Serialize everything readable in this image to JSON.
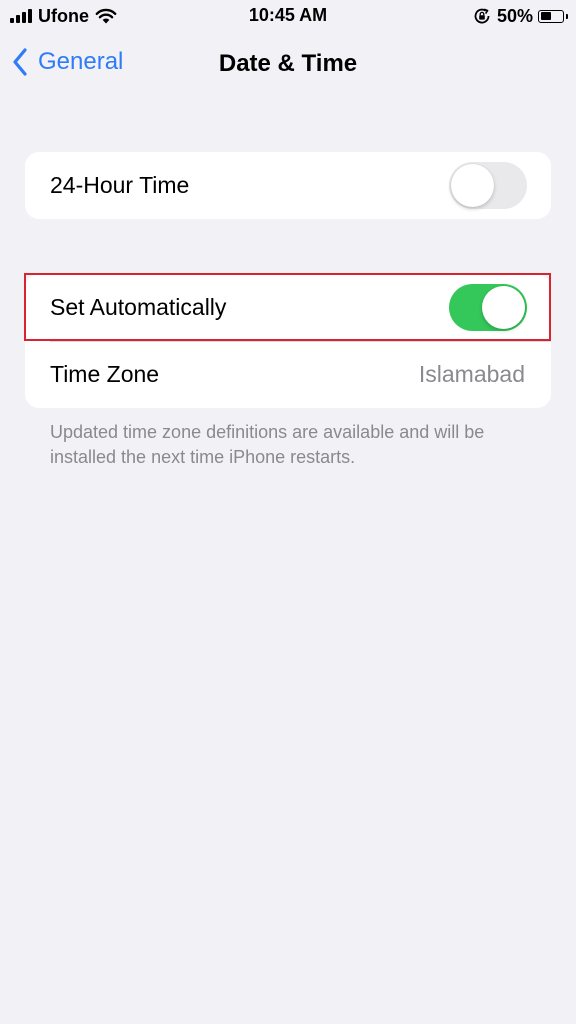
{
  "status_bar": {
    "carrier": "Ufone",
    "time": "10:45 AM",
    "battery_percent": "50%",
    "battery_level": 0.5,
    "icons": [
      "signal-icon",
      "wifi-icon",
      "orientation-lock-icon",
      "battery-icon"
    ]
  },
  "nav": {
    "back_label": "General",
    "title": "Date & Time",
    "accent_color": "#2f7cf6"
  },
  "settings": {
    "hour_24": {
      "label": "24-Hour Time",
      "enabled": false
    },
    "set_automatically": {
      "label": "Set Automatically",
      "enabled": true
    },
    "time_zone": {
      "label": "Time Zone",
      "value": "Islamabad"
    },
    "footnote": "Updated time zone definitions are available and will be installed the next time iPhone restarts."
  },
  "colors": {
    "background": "#f2f1f6",
    "toggle_on": "#34c759",
    "toggle_off": "#e9e9eb",
    "highlight": "#d8242c"
  }
}
